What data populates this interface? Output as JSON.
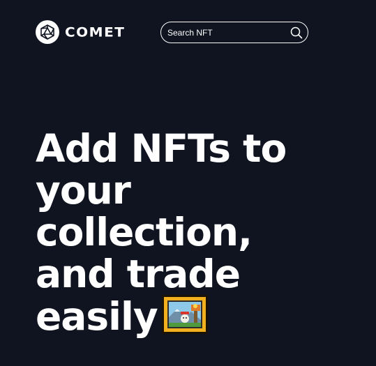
{
  "header": {
    "logo_text": "COMET",
    "logo_icon": "polyhedron-logo-icon",
    "search": {
      "placeholder": "Search NFT",
      "value": "",
      "icon": "search-icon"
    }
  },
  "hero": {
    "line1": "Add NFTs to",
    "line2": "your",
    "line3": "collection,",
    "line4": "and trade",
    "line5": "easily",
    "emoji_icon": "framed-picture-icon"
  },
  "colors": {
    "background": "#0f1420",
    "text": "#ffffff",
    "frame_gold": "#f2b01e"
  }
}
